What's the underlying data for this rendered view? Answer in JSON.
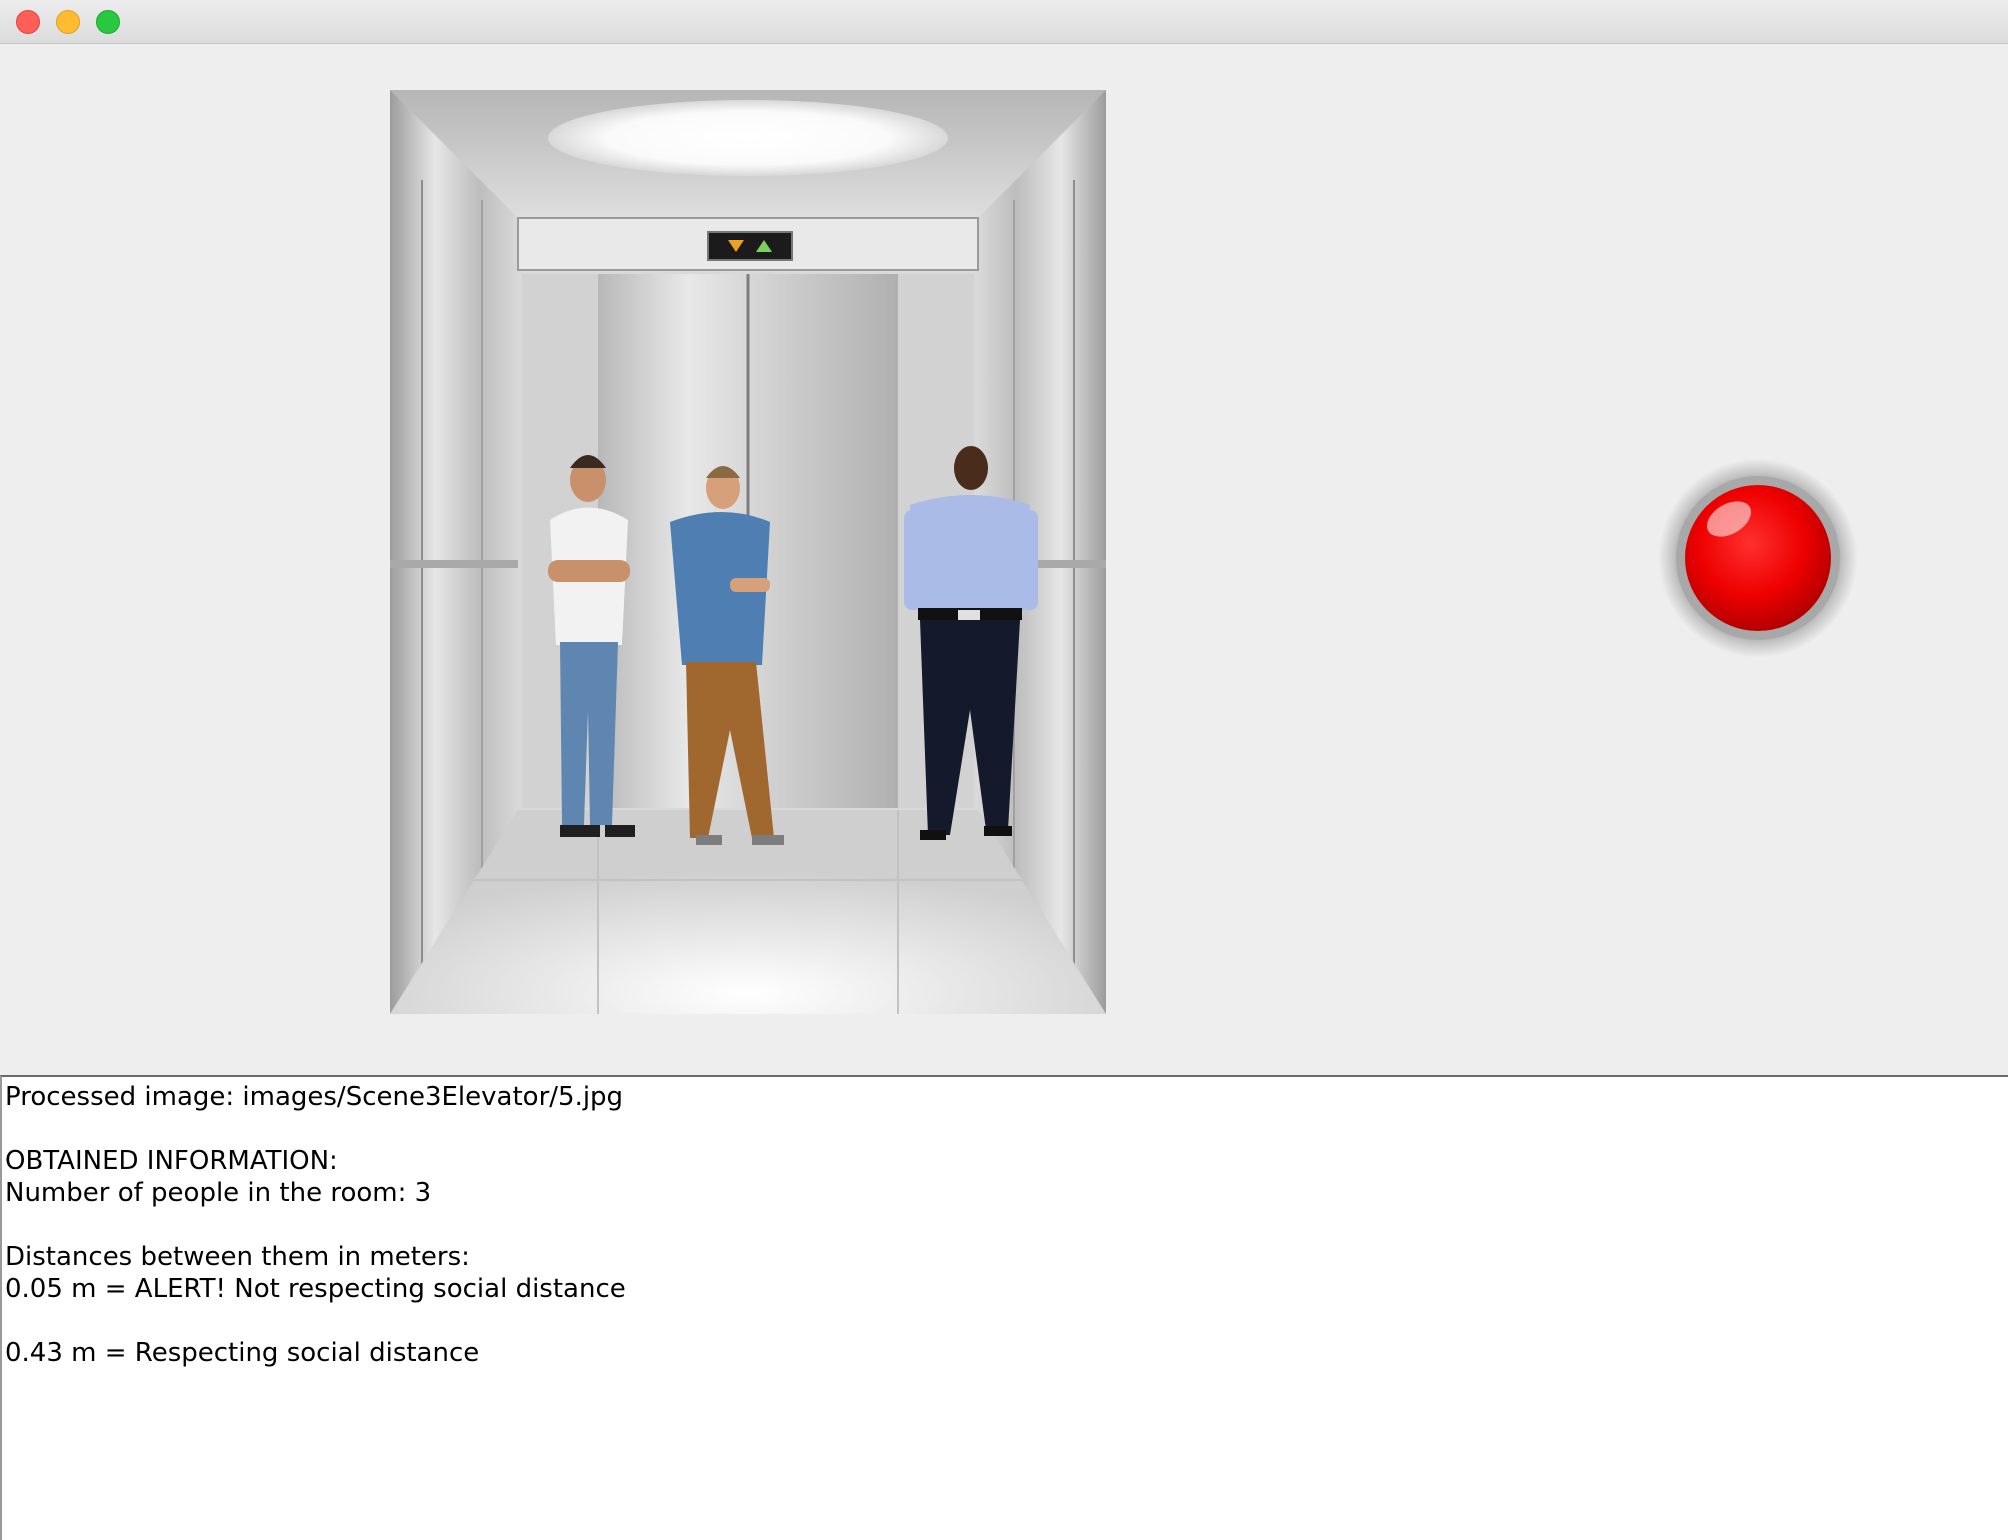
{
  "window": {
    "controls": {
      "close": "close-button",
      "minimize": "minimize-button",
      "maximize": "maximize-button"
    }
  },
  "image_panel": {
    "image": {
      "description_icon": "elevator-photo",
      "people_count_shown": 3
    },
    "alert_light": {
      "icon": "red-alert-light-icon",
      "color": "#ee0000"
    }
  },
  "info": {
    "lines": [
      "Processed image: images/Scene3Elevator/5.jpg",
      "",
      "OBTAINED INFORMATION:",
      "Number of people in the room: 3",
      "",
      "Distances between them in meters:",
      "0.05 m = ALERT! Not respecting social distance",
      "",
      "0.43 m = Respecting social distance"
    ]
  },
  "colors": {
    "panel_bg": "#eeeeee",
    "text_area_bg": "#ffffff",
    "alert_red": "#ee0000"
  }
}
